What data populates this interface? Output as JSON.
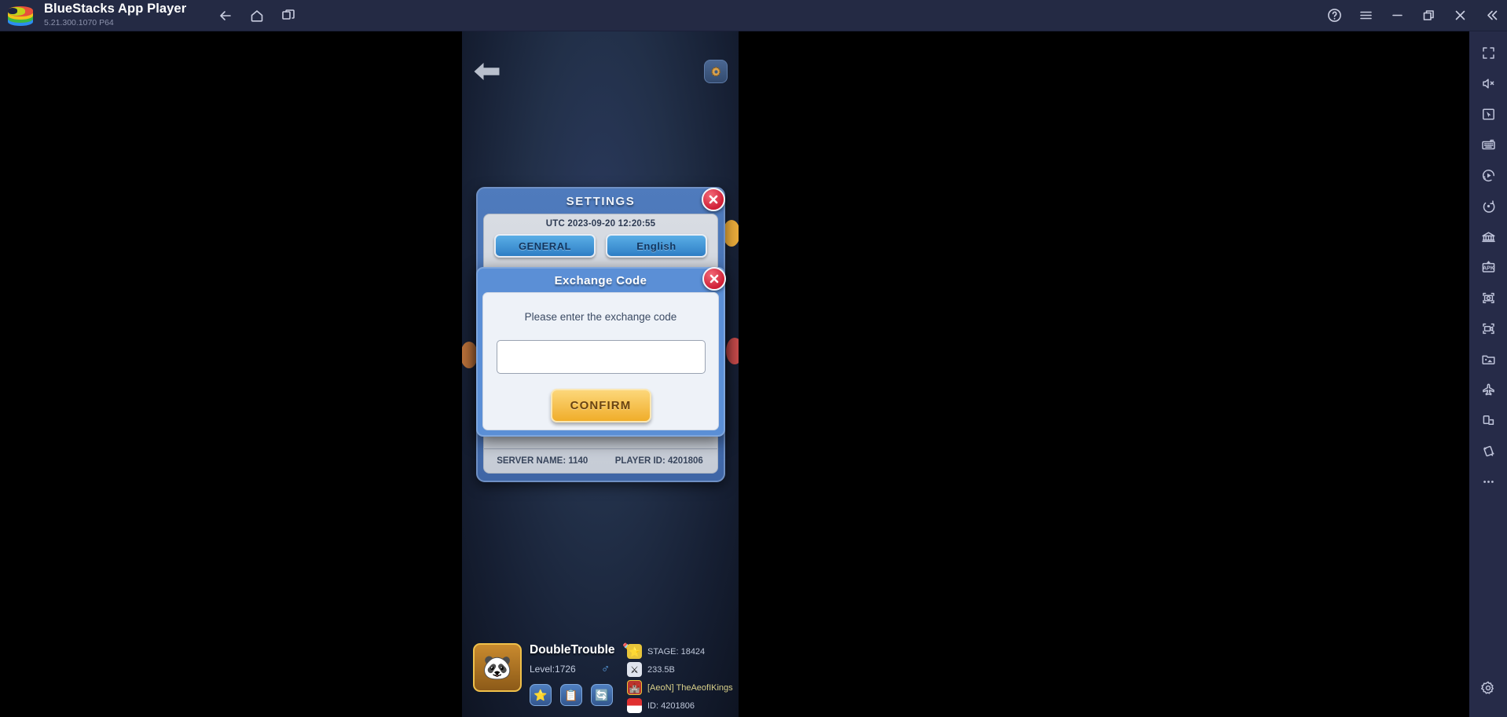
{
  "titlebar": {
    "app_name": "BlueStacks App Player",
    "version": "5.21.300.1070  P64",
    "nav": [
      {
        "name": "back-button",
        "icon": "arrow-left-icon"
      },
      {
        "name": "home-button",
        "icon": "home-icon"
      },
      {
        "name": "multi-instance-button",
        "icon": "windows-icon"
      }
    ],
    "right": [
      {
        "name": "help-button",
        "icon": "help-circle-icon"
      },
      {
        "name": "menu-button",
        "icon": "hamburger-menu-icon"
      },
      {
        "name": "minimize-button",
        "icon": "minimize-icon"
      },
      {
        "name": "restore-button",
        "icon": "restore-window-icon"
      },
      {
        "name": "close-button",
        "icon": "close-icon"
      },
      {
        "name": "collapse-sidebar-button",
        "icon": "double-chevron-left-icon"
      }
    ]
  },
  "sidebar": {
    "items": [
      {
        "name": "fullscreen-button",
        "icon": "fullscreen-icon"
      },
      {
        "name": "mute-button",
        "icon": "speaker-mute-icon"
      },
      {
        "name": "cursor-mode-button",
        "icon": "pointer-icon"
      },
      {
        "name": "keyboard-controls-button",
        "icon": "keyboard-icon"
      },
      {
        "name": "macro-recorder-button",
        "icon": "macro-play-icon"
      },
      {
        "name": "rotate-button",
        "icon": "rotate-icon"
      },
      {
        "name": "multi-instance-manager-button",
        "icon": "instance-manager-icon"
      },
      {
        "name": "install-apk-button",
        "icon": "apk-icon"
      },
      {
        "name": "screenshot-button",
        "icon": "camera-icon"
      },
      {
        "name": "record-screen-button",
        "icon": "video-camera-icon"
      },
      {
        "name": "media-manager-button",
        "icon": "gallery-folder-icon"
      },
      {
        "name": "eco-mode-button",
        "icon": "airplane-icon"
      },
      {
        "name": "tilt-button",
        "icon": "tilt-device-icon"
      },
      {
        "name": "shake-button",
        "icon": "shake-icon"
      },
      {
        "name": "more-button",
        "icon": "ellipsis-icon"
      }
    ],
    "settings_item": {
      "name": "bluestacks-settings-button",
      "icon": "gear-icon"
    }
  },
  "game": {
    "back_icon": "back-arrow-icon",
    "gear_icon": "gear-icon",
    "settings_panel": {
      "title": "SETTINGS",
      "close_label": "✖",
      "utc_time": "UTC 2023-09-20 12:20:55",
      "buttons": [
        {
          "label": "GENERAL",
          "name": "general-button"
        },
        {
          "label": "English",
          "name": "language-button"
        }
      ],
      "server_name": "SERVER NAME: 1140",
      "player_id": "PLAYER ID: 4201806"
    },
    "exchange_dialog": {
      "title": "Exchange Code",
      "close_label": "✖",
      "prompt": "Please enter the exchange code",
      "input_value": "",
      "input_placeholder": "",
      "confirm_label": "CONFIRM"
    },
    "profile": {
      "avatar_icon": "panda-avatar-icon",
      "name": "DoubleTrouble",
      "edit_icon": "pencil-icon",
      "level": "Level:1726",
      "gender": "♂",
      "buttons": [
        {
          "name": "profile-star-button",
          "icon": "star-icon",
          "glyph": "⭐"
        },
        {
          "name": "profile-list-button",
          "icon": "list-icon",
          "glyph": "📋"
        },
        {
          "name": "profile-refresh-button",
          "icon": "refresh-icon",
          "glyph": "🔄"
        }
      ],
      "stats": [
        {
          "name": "stage-stat",
          "icon": "star-icon",
          "glyph": "⭐",
          "text": "STAGE: 18424",
          "style": "normal"
        },
        {
          "name": "power-stat",
          "icon": "swords-icon",
          "glyph": "⚔",
          "text": "233.5B",
          "style": "normal"
        },
        {
          "name": "guild-stat",
          "icon": "guild-shield-icon",
          "glyph": "🏰",
          "text": "[AeoN] TheAeofIKings",
          "style": "guild"
        },
        {
          "name": "country-stat",
          "icon": "flag-icon",
          "glyph": "",
          "text": "ID: 4201806",
          "style": "normal"
        }
      ]
    }
  },
  "colors": {
    "titlebar_bg": "#242a44",
    "sidebar_bg": "#262b48",
    "dialog_blue": "#5b8fd6",
    "confirm_gold": "#f0ad2a",
    "close_red": "#cf1f36"
  }
}
